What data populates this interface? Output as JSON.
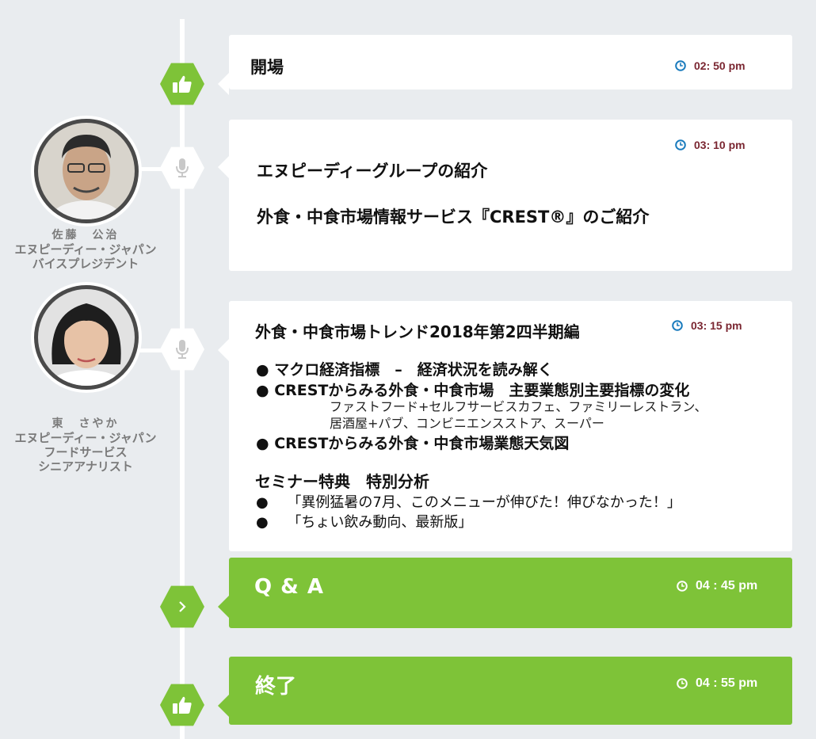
{
  "colors": {
    "accent_green": "#7ec338",
    "time_red": "#7a2631",
    "clock_blue": "#1a7bbd",
    "background": "#e9ecef"
  },
  "events": [
    {
      "icon": "thumbs-up-icon",
      "title": "開場",
      "time": "02: 50 pm"
    },
    {
      "icon": "microphone-icon",
      "time": "03: 10 pm",
      "lines": [
        "エヌピーディーグループの紹介",
        "外食・中食市場情報サービス『CREST®』のご紹介"
      ]
    },
    {
      "icon": "microphone-icon",
      "title": "外食・中食市場トレンド2018年第2四半期編",
      "time": "03: 15 pm",
      "bullets": [
        "● マクロ経済指標　–　経済状況を読み解く",
        "● CRESTからみる外食・中食市場　主要業態別主要指標の変化",
        "● CRESTからみる外食・中食市場業態天気図"
      ],
      "sub_lines": [
        "ファストフード+セルフサービスカフェ、ファミリーレストラン、",
        "居酒屋+パブ、コンビニエンスストア、スーパー"
      ],
      "special_title": "セミナー特典　特別分析",
      "special_items": [
        "●　 「異例猛暑の7月、このメニューが伸びた！伸びなかった！」",
        "●　 「ちょい飲み動向、最新版」"
      ]
    },
    {
      "icon": "chevron-right-icon",
      "title": "Q & A",
      "time": "04 : 45 pm"
    },
    {
      "icon": "thumbs-up-icon",
      "title": "終了",
      "time": "04 : 55 pm"
    }
  ],
  "speakers": [
    {
      "name": "佐藤　公治",
      "org": "エヌピーディー・ジャパン",
      "role": "バイスプレジデント"
    },
    {
      "name": "東　さやか",
      "org": "エヌピーディー・ジャパン",
      "dept": "フードサービス",
      "role": "シニアアナリスト"
    }
  ]
}
